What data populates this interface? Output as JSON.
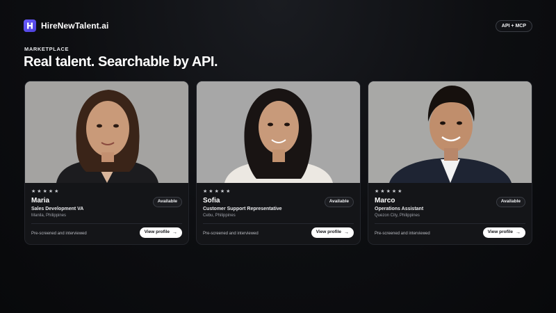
{
  "brand": {
    "name": "HireNewTalent.ai",
    "logo_icon": "h-logo-icon",
    "accent": "#5b4ff0"
  },
  "header": {
    "api_badge": "API + MCP"
  },
  "hero": {
    "eyebrow": "MARKETPLACE",
    "headline": "Real talent. Searchable by API."
  },
  "cards": [
    {
      "name": "Maria",
      "role": "Sales Development VA",
      "location": "Manila, Philippines",
      "status": "Available",
      "rating": 5,
      "note": "Pre-screened and interviewed",
      "cta": "View profile"
    },
    {
      "name": "Sofia",
      "role": "Customer Support Representative",
      "location": "Cebu, Philippines",
      "status": "Available",
      "rating": 5,
      "note": "Pre-screened and interviewed",
      "cta": "View profile"
    },
    {
      "name": "Marco",
      "role": "Operations Assistant",
      "location": "Quezon City, Philippines",
      "status": "Available",
      "rating": 5,
      "note": "Pre-screened and interviewed",
      "cta": "View profile"
    }
  ],
  "star_glyph": "★",
  "arrow_glyph": "→"
}
